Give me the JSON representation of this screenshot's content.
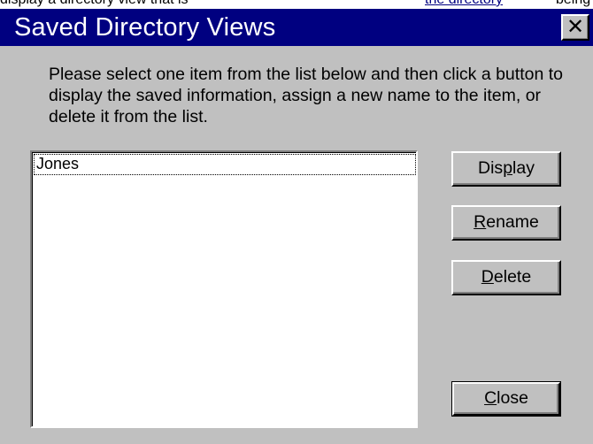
{
  "background_page": {
    "fragment_left": "display a directory view that is",
    "fragment_link": "the directory",
    "fragment_right": "being"
  },
  "dialog": {
    "title": "Saved Directory Views",
    "close_glyph": "✕",
    "instructions": "Please select one item from the list below and then click a button to display the saved information, assign a new name to the item, or delete it from the list."
  },
  "list": {
    "items": [
      {
        "label": "Jones",
        "selected": true
      }
    ]
  },
  "buttons": {
    "display": {
      "before": "Dis",
      "accel": "p",
      "after": "lay"
    },
    "rename": {
      "before": "",
      "accel": "R",
      "after": "ename"
    },
    "delete": {
      "before": "",
      "accel": "D",
      "after": "elete"
    },
    "close": {
      "before": "",
      "accel": "C",
      "after": "lose"
    }
  },
  "colors": {
    "titlebar": "#000080",
    "dialog_face": "#c0c0c0",
    "list_bg": "#ffffff"
  }
}
